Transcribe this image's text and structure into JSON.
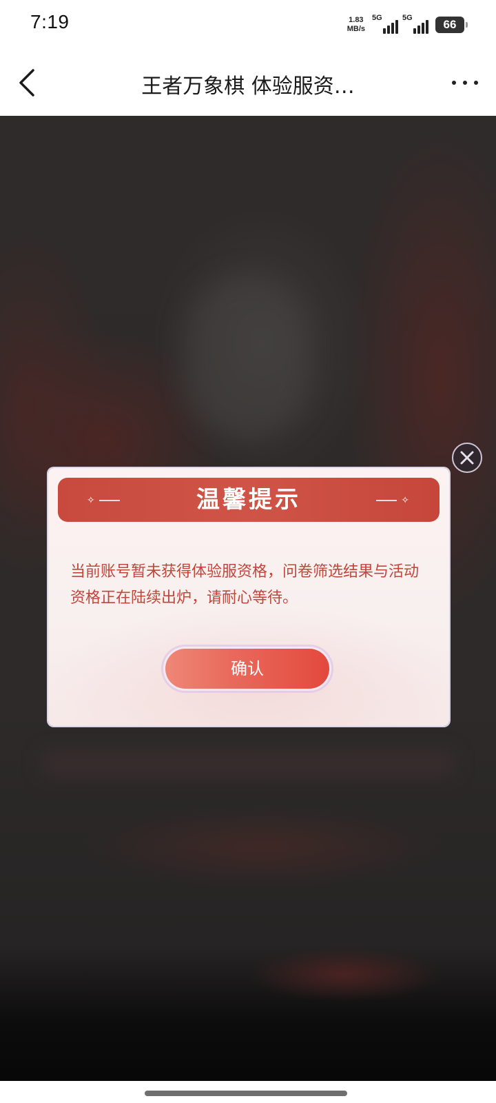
{
  "status_bar": {
    "time": "7:19",
    "net_speed_value": "1.83",
    "net_speed_unit": "MB/s",
    "sim1_tag": "5G",
    "sim2_tag": "5G",
    "battery_level": "66"
  },
  "nav": {
    "title": "王者万象棋 体验服资…",
    "back_icon": "chevron-left-icon",
    "more_icon": "more-horizontal-icon"
  },
  "dialog": {
    "title": "温馨提示",
    "message": "当前账号暂未获得体验服资格，问卷筛选结果与活动资格正在陆续出炉，请耐心等待。",
    "confirm_label": "确认",
    "close_icon": "close-circle-icon",
    "header_color": "#c84a3f",
    "text_color": "#c0463a"
  }
}
